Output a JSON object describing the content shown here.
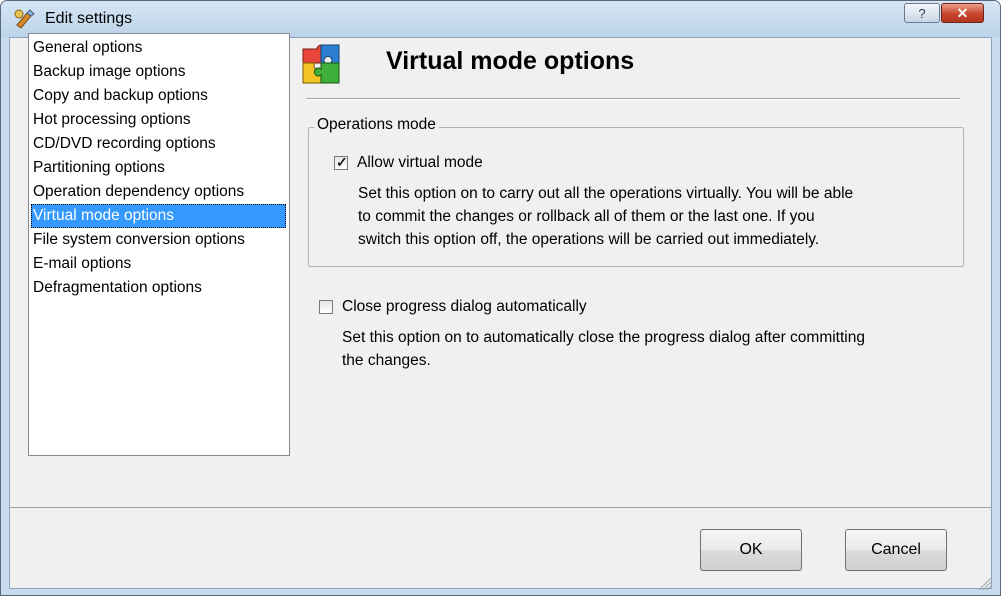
{
  "window": {
    "title": "Edit settings",
    "help_label": "?",
    "close_label": "✕"
  },
  "sidebar": {
    "items": [
      {
        "label": "General options",
        "selected": false
      },
      {
        "label": "Backup image options",
        "selected": false
      },
      {
        "label": "Copy and backup options",
        "selected": false
      },
      {
        "label": "Hot processing options",
        "selected": false
      },
      {
        "label": "CD/DVD recording options",
        "selected": false
      },
      {
        "label": "Partitioning options",
        "selected": false
      },
      {
        "label": "Operation dependency options",
        "selected": false
      },
      {
        "label": "Virtual mode options",
        "selected": true
      },
      {
        "label": "File system conversion options",
        "selected": false
      },
      {
        "label": "E-mail options",
        "selected": false
      },
      {
        "label": "Defragmentation options",
        "selected": false
      }
    ]
  },
  "header": {
    "icon": "puzzle-icon",
    "title": "Virtual mode options"
  },
  "operations_group": {
    "label": "Operations mode",
    "allow_virtual": {
      "label": "Allow virtual mode",
      "checked": true,
      "description_lines": [
        "Set this option on to carry out all the operations virtually. You will be able",
        "to commit the changes or rollback all of them or the last one. If you",
        "switch this option off, the operations will be carried out immediately."
      ]
    }
  },
  "close_progress": {
    "label": "Close progress dialog automatically",
    "checked": false,
    "description_lines": [
      "Set this option on to automatically close the progress dialog after committing",
      "the changes."
    ]
  },
  "buttons": {
    "ok": "OK",
    "cancel": "Cancel"
  },
  "colors": {
    "selection": "#3399ff",
    "title_bar": "#c9dcef",
    "close_button": "#c8452c"
  }
}
